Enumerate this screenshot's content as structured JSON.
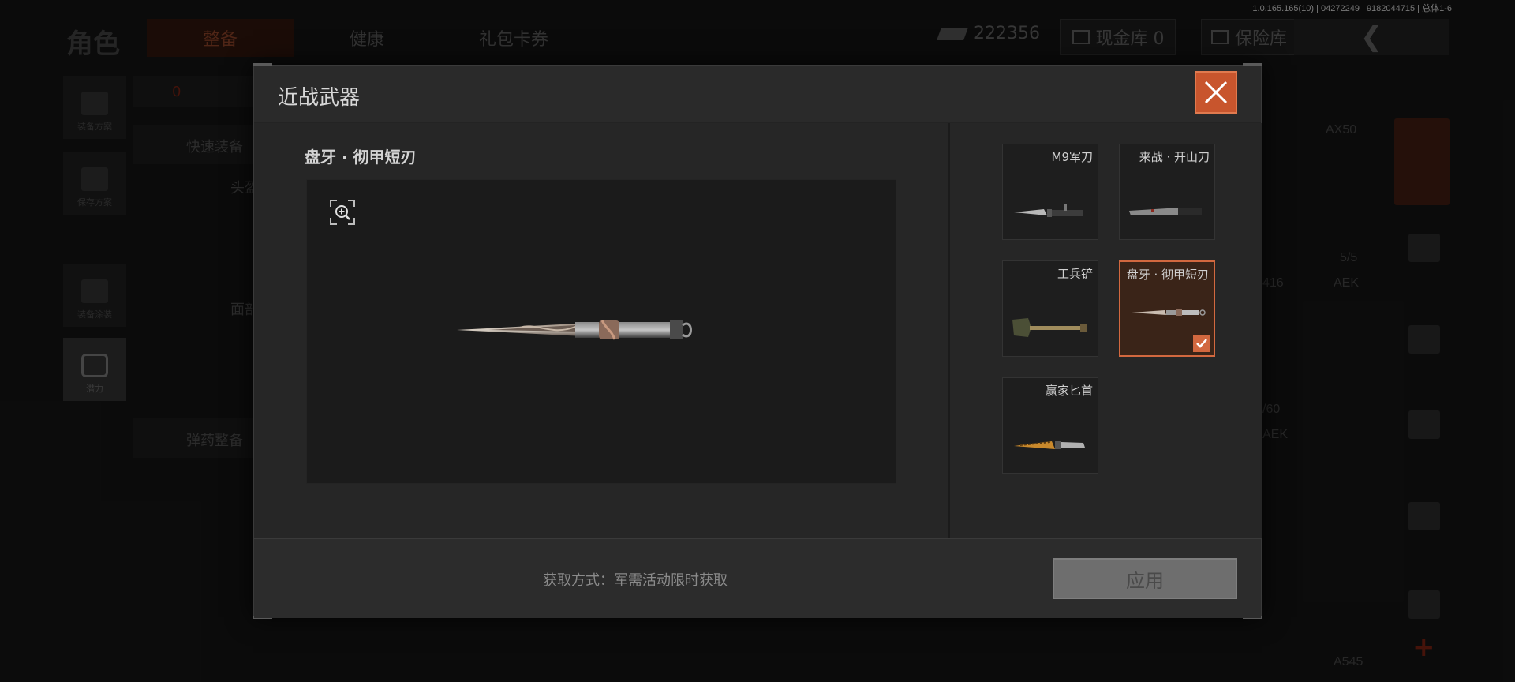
{
  "version_info": "1.0.165.165(10) | 04272249 | 9182044715 | 总体1-6",
  "background": {
    "page_title": "角色",
    "tabs": [
      {
        "label": "整备",
        "active": true
      },
      {
        "label": "健康",
        "active": false
      },
      {
        "label": "礼包卡券",
        "active": false
      }
    ],
    "currency_amount": "222356",
    "cash_vault_label": "现金库 0",
    "insurance_label": "保险库",
    "left_nav": [
      "装备方案",
      "保存方案",
      "装备涂装",
      "潜力"
    ],
    "quick_equip_label": "快速装备",
    "ammo_label": "弹药整备",
    "helmet_label": "头盔",
    "face_label": "面部",
    "right_labels": [
      "AX50",
      "5/5",
      "AEK",
      "416",
      "/60",
      "AEK",
      "A545"
    ],
    "slot_count": "0"
  },
  "modal": {
    "title": "近战武器",
    "selected_name": "盘牙 · 彻甲短刃",
    "items": [
      {
        "name": "M9军刀",
        "selected": false
      },
      {
        "name": "来战 · 开山刀",
        "selected": false
      },
      {
        "name": "工兵铲",
        "selected": false
      },
      {
        "name": "盘牙 · 彻甲短刃",
        "selected": true
      },
      {
        "name": "赢家匕首",
        "selected": false
      }
    ],
    "acquire_text": "获取方式：军需活动限时获取",
    "apply_label": "应用"
  },
  "colors": {
    "accent": "#d2683f",
    "close_bg": "#c8552d",
    "selected_bg": "#3a2418",
    "apply_disabled": "#6e6e6e"
  },
  "icons": {
    "close": "close-icon",
    "zoom": "zoom-in-icon",
    "check": "check-icon",
    "back": "back-arrow-icon"
  }
}
